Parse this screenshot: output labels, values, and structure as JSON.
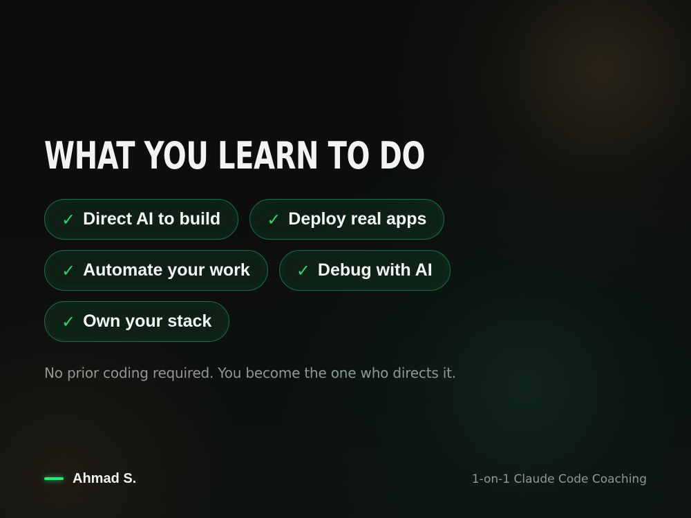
{
  "title": "WHAT YOU LEARN TO DO",
  "skills": [
    {
      "label": "Direct AI to build",
      "icon": "check-icon",
      "check_glyph": "✓"
    },
    {
      "label": "Deploy real apps",
      "icon": "check-icon",
      "check_glyph": "✓"
    },
    {
      "label": "Automate your work",
      "icon": "check-icon",
      "check_glyph": "✓"
    },
    {
      "label": "Debug with AI",
      "icon": "check-icon",
      "check_glyph": "✓"
    },
    {
      "label": "Own your stack",
      "icon": "check-icon",
      "check_glyph": "✓"
    }
  ],
  "subtitle": "No prior coding required. You become the one who directs it.",
  "footer": {
    "author": "Ahmad S.",
    "tagline": "1-on-1 Claude Code Coaching"
  },
  "colors": {
    "accent": "#2ee67a",
    "check": "#2fd372",
    "pill_border": "#1f6e43",
    "text_primary": "#f2f4f3",
    "text_muted": "#8e9894",
    "background": "#0b0d0d"
  }
}
